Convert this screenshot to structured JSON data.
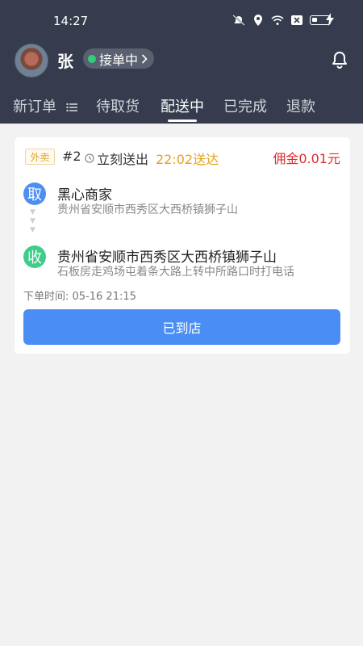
{
  "status_bar": {
    "time": "14:27"
  },
  "profile": {
    "name": "张",
    "status": "接单中",
    "status_color": "#2fd07a"
  },
  "tabs": [
    {
      "label": "新订单"
    },
    {
      "label": "待取货"
    },
    {
      "label": "配送中",
      "active": true
    },
    {
      "label": "已完成"
    },
    {
      "label": "退款"
    }
  ],
  "order": {
    "tag": "外卖",
    "number": "#2",
    "dispatch": "立刻送出",
    "eta": "22:02送达",
    "commission": "佣金0.01元",
    "pickup_badge": "取",
    "merchant_name": "黑心商家",
    "merchant_address": "贵州省安顺市西秀区大西桥镇狮子山",
    "drop_badge": "收",
    "dest_address": "贵州省安顺市西秀区大西桥镇狮子山",
    "dest_note": "石板房走鸡场屯着条大路上转中所路口时打电话",
    "order_time": "下单时间: 05-16 21:15",
    "action": "已到店"
  },
  "colors": {
    "header_bg": "#363c4e",
    "primary": "#4a8ef5",
    "accent_orange": "#e3a21f",
    "accent_red": "#e02c2c",
    "pickup_blue": "#4c8ff0",
    "drop_green": "#3fcd8a"
  }
}
